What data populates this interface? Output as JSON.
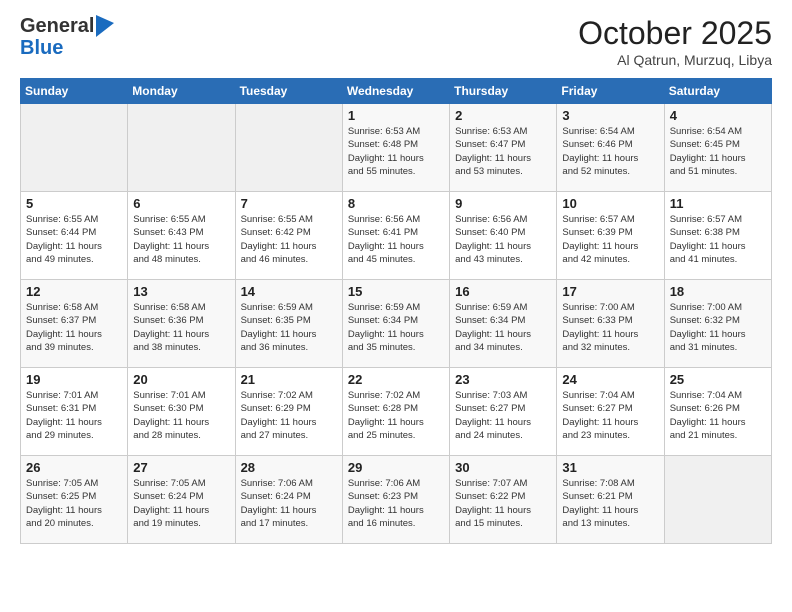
{
  "header": {
    "logo_line1": "General",
    "logo_line2": "Blue",
    "month_title": "October 2025",
    "location": "Al Qatrun, Murzuq, Libya"
  },
  "weekdays": [
    "Sunday",
    "Monday",
    "Tuesday",
    "Wednesday",
    "Thursday",
    "Friday",
    "Saturday"
  ],
  "weeks": [
    [
      {
        "day": "",
        "info": ""
      },
      {
        "day": "",
        "info": ""
      },
      {
        "day": "",
        "info": ""
      },
      {
        "day": "1",
        "info": "Sunrise: 6:53 AM\nSunset: 6:48 PM\nDaylight: 11 hours\nand 55 minutes."
      },
      {
        "day": "2",
        "info": "Sunrise: 6:53 AM\nSunset: 6:47 PM\nDaylight: 11 hours\nand 53 minutes."
      },
      {
        "day": "3",
        "info": "Sunrise: 6:54 AM\nSunset: 6:46 PM\nDaylight: 11 hours\nand 52 minutes."
      },
      {
        "day": "4",
        "info": "Sunrise: 6:54 AM\nSunset: 6:45 PM\nDaylight: 11 hours\nand 51 minutes."
      }
    ],
    [
      {
        "day": "5",
        "info": "Sunrise: 6:55 AM\nSunset: 6:44 PM\nDaylight: 11 hours\nand 49 minutes."
      },
      {
        "day": "6",
        "info": "Sunrise: 6:55 AM\nSunset: 6:43 PM\nDaylight: 11 hours\nand 48 minutes."
      },
      {
        "day": "7",
        "info": "Sunrise: 6:55 AM\nSunset: 6:42 PM\nDaylight: 11 hours\nand 46 minutes."
      },
      {
        "day": "8",
        "info": "Sunrise: 6:56 AM\nSunset: 6:41 PM\nDaylight: 11 hours\nand 45 minutes."
      },
      {
        "day": "9",
        "info": "Sunrise: 6:56 AM\nSunset: 6:40 PM\nDaylight: 11 hours\nand 43 minutes."
      },
      {
        "day": "10",
        "info": "Sunrise: 6:57 AM\nSunset: 6:39 PM\nDaylight: 11 hours\nand 42 minutes."
      },
      {
        "day": "11",
        "info": "Sunrise: 6:57 AM\nSunset: 6:38 PM\nDaylight: 11 hours\nand 41 minutes."
      }
    ],
    [
      {
        "day": "12",
        "info": "Sunrise: 6:58 AM\nSunset: 6:37 PM\nDaylight: 11 hours\nand 39 minutes."
      },
      {
        "day": "13",
        "info": "Sunrise: 6:58 AM\nSunset: 6:36 PM\nDaylight: 11 hours\nand 38 minutes."
      },
      {
        "day": "14",
        "info": "Sunrise: 6:59 AM\nSunset: 6:35 PM\nDaylight: 11 hours\nand 36 minutes."
      },
      {
        "day": "15",
        "info": "Sunrise: 6:59 AM\nSunset: 6:34 PM\nDaylight: 11 hours\nand 35 minutes."
      },
      {
        "day": "16",
        "info": "Sunrise: 6:59 AM\nSunset: 6:34 PM\nDaylight: 11 hours\nand 34 minutes."
      },
      {
        "day": "17",
        "info": "Sunrise: 7:00 AM\nSunset: 6:33 PM\nDaylight: 11 hours\nand 32 minutes."
      },
      {
        "day": "18",
        "info": "Sunrise: 7:00 AM\nSunset: 6:32 PM\nDaylight: 11 hours\nand 31 minutes."
      }
    ],
    [
      {
        "day": "19",
        "info": "Sunrise: 7:01 AM\nSunset: 6:31 PM\nDaylight: 11 hours\nand 29 minutes."
      },
      {
        "day": "20",
        "info": "Sunrise: 7:01 AM\nSunset: 6:30 PM\nDaylight: 11 hours\nand 28 minutes."
      },
      {
        "day": "21",
        "info": "Sunrise: 7:02 AM\nSunset: 6:29 PM\nDaylight: 11 hours\nand 27 minutes."
      },
      {
        "day": "22",
        "info": "Sunrise: 7:02 AM\nSunset: 6:28 PM\nDaylight: 11 hours\nand 25 minutes."
      },
      {
        "day": "23",
        "info": "Sunrise: 7:03 AM\nSunset: 6:27 PM\nDaylight: 11 hours\nand 24 minutes."
      },
      {
        "day": "24",
        "info": "Sunrise: 7:04 AM\nSunset: 6:27 PM\nDaylight: 11 hours\nand 23 minutes."
      },
      {
        "day": "25",
        "info": "Sunrise: 7:04 AM\nSunset: 6:26 PM\nDaylight: 11 hours\nand 21 minutes."
      }
    ],
    [
      {
        "day": "26",
        "info": "Sunrise: 7:05 AM\nSunset: 6:25 PM\nDaylight: 11 hours\nand 20 minutes."
      },
      {
        "day": "27",
        "info": "Sunrise: 7:05 AM\nSunset: 6:24 PM\nDaylight: 11 hours\nand 19 minutes."
      },
      {
        "day": "28",
        "info": "Sunrise: 7:06 AM\nSunset: 6:24 PM\nDaylight: 11 hours\nand 17 minutes."
      },
      {
        "day": "29",
        "info": "Sunrise: 7:06 AM\nSunset: 6:23 PM\nDaylight: 11 hours\nand 16 minutes."
      },
      {
        "day": "30",
        "info": "Sunrise: 7:07 AM\nSunset: 6:22 PM\nDaylight: 11 hours\nand 15 minutes."
      },
      {
        "day": "31",
        "info": "Sunrise: 7:08 AM\nSunset: 6:21 PM\nDaylight: 11 hours\nand 13 minutes."
      },
      {
        "day": "",
        "info": ""
      }
    ]
  ]
}
